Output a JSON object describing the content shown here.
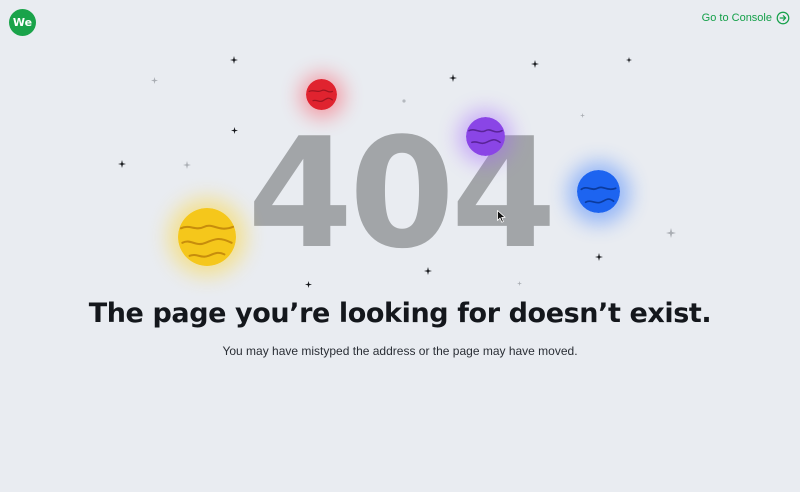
{
  "header": {
    "logo_text": "We",
    "console_link": "Go to Console",
    "console_icon": "arrow-right-circle-icon",
    "accent_color": "#15a04a"
  },
  "hero": {
    "error_code": "404",
    "headline": "The page you’re looking for doesn’t exist.",
    "subtext": "You may have mistyped the address or the page may have moved."
  },
  "planet_colors": {
    "red": "#e0232f",
    "purple": "#8a45e6",
    "blue": "#1d64f0",
    "yellow": "#f5c71b"
  }
}
